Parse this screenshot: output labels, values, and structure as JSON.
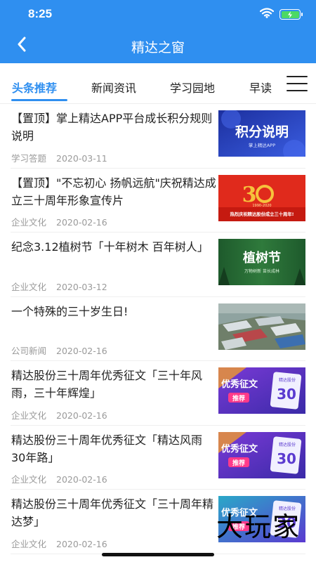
{
  "status": {
    "time": "8:25"
  },
  "nav": {
    "title": "精达之窗"
  },
  "tabs": [
    "头条推荐",
    "新闻资讯",
    "学习园地",
    "早读"
  ],
  "articles": [
    {
      "title": "【置顶】掌上精达APP平台成长积分规则说明",
      "category": "学习答题",
      "date": "2020-03-11",
      "thumb": {
        "heading": "积分说明",
        "caption": "掌上精达APP"
      }
    },
    {
      "title": "【置顶】\"不忘初心 扬帆远航\"庆祝精达成立三十周年形象宣传片",
      "category": "企业文化",
      "date": "2020-02-16",
      "thumb": {
        "range": "1990-2020",
        "caption": "热烈庆祝精达股份成立三十周年!"
      }
    },
    {
      "title": "纪念3.12植树节「十年树木 百年树人」",
      "category": "企业文化",
      "date": "2020-03-12",
      "thumb": {
        "heading": "植树节",
        "caption": "万物树新 苗长成林"
      }
    },
    {
      "title": "一个特殊的三十岁生日!",
      "category": "公司新闻",
      "date": "2020-02-16",
      "thumb": {}
    },
    {
      "title": "精达股份三十周年优秀征文「三十年风雨，三十年辉煌」",
      "category": "企业文化",
      "date": "2020-02-16",
      "thumb": {
        "heading": "优秀征文",
        "badge": "推荐",
        "brand": "精达股份",
        "number": "30"
      }
    },
    {
      "title": "精达股份三十周年优秀征文「精达风雨30年路」",
      "category": "企业文化",
      "date": "2020-02-16",
      "thumb": {
        "heading": "优秀征文",
        "badge": "推荐",
        "brand": "精达股份",
        "number": "30"
      }
    },
    {
      "title": "精达股份三十周年优秀征文「三十周年精达梦」",
      "category": "企业文化",
      "date": "2020-02-16",
      "thumb": {
        "heading": "优秀征文",
        "badge": "推荐",
        "brand": "精达股份",
        "number": "30"
      }
    }
  ],
  "watermark": "大玩家",
  "colors": {
    "primary": "#2f8ff0",
    "text": "#222222",
    "meta": "#9a9a9a"
  },
  "icons": {
    "back": "chevron-left-icon",
    "menu": "hamburger-menu-icon",
    "wifi": "wifi-icon",
    "battery": "battery-charging-icon"
  }
}
